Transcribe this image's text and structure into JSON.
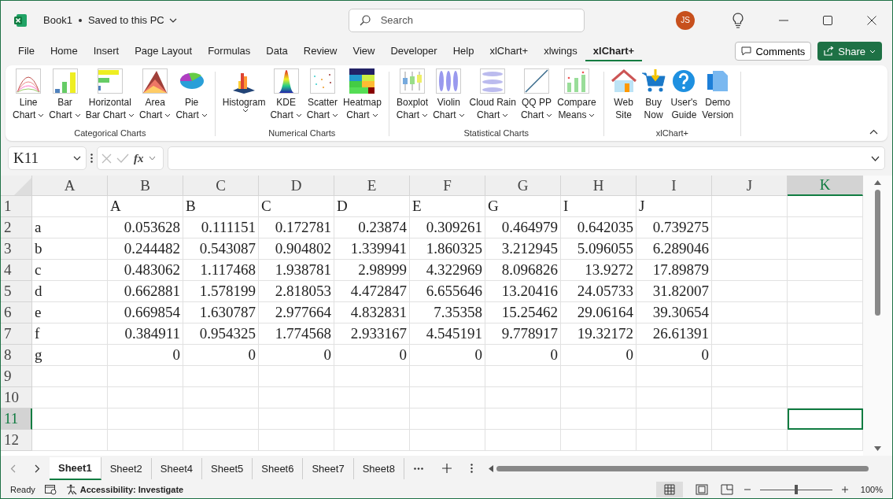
{
  "title_bar": {
    "file_name": "Book1",
    "save_status": "Saved to this PC",
    "search_placeholder": "Search",
    "user_initials": "JS"
  },
  "menu_tabs": [
    {
      "label": "File",
      "selected": false
    },
    {
      "label": "Home",
      "selected": false
    },
    {
      "label": "Insert",
      "selected": false
    },
    {
      "label": "Page Layout",
      "selected": false
    },
    {
      "label": "Formulas",
      "selected": false
    },
    {
      "label": "Data",
      "selected": false
    },
    {
      "label": "Review",
      "selected": false
    },
    {
      "label": "View",
      "selected": false
    },
    {
      "label": "Developer",
      "selected": false
    },
    {
      "label": "Help",
      "selected": false
    },
    {
      "label": "xlChart+",
      "selected": false
    },
    {
      "label": "xlwings",
      "selected": false
    },
    {
      "label": "xlChart+",
      "selected": true
    }
  ],
  "comments_button": "Comments",
  "share_button": "Share",
  "ribbon_groups": [
    {
      "label": "Categorical Charts",
      "buttons": [
        {
          "kind": "line",
          "lines": [
            "Line",
            "Chart"
          ],
          "dropdown": true
        },
        {
          "kind": "bar",
          "lines": [
            "Bar",
            "Chart"
          ],
          "dropdown": true
        },
        {
          "kind": "hbar",
          "lines": [
            "Horizontal",
            "Bar Chart"
          ],
          "dropdown": true
        },
        {
          "kind": "area",
          "lines": [
            "Area",
            "Chart"
          ],
          "dropdown": true
        },
        {
          "kind": "pie",
          "lines": [
            "Pie",
            "Chart"
          ],
          "dropdown": true
        }
      ]
    },
    {
      "label": "Numerical Charts",
      "buttons": [
        {
          "kind": "histogram",
          "lines": [
            "Histogram"
          ],
          "dropdown": true
        },
        {
          "kind": "kde",
          "lines": [
            "KDE",
            "Chart"
          ],
          "dropdown": true
        },
        {
          "kind": "scatter",
          "lines": [
            "Scatter",
            "Chart"
          ],
          "dropdown": true
        },
        {
          "kind": "heatmap",
          "lines": [
            "Heatmap",
            "Chart"
          ],
          "dropdown": true
        }
      ]
    },
    {
      "label": "Statistical Charts",
      "buttons": [
        {
          "kind": "boxplot",
          "lines": [
            "Boxplot",
            "Chart"
          ],
          "dropdown": true
        },
        {
          "kind": "violin",
          "lines": [
            "Violin",
            "Chart"
          ],
          "dropdown": true
        },
        {
          "kind": "cloud",
          "lines": [
            "Cloud Rain",
            "Chart"
          ],
          "dropdown": true
        },
        {
          "kind": "qq",
          "lines": [
            "QQ PP",
            "Chart"
          ],
          "dropdown": true
        },
        {
          "kind": "means",
          "lines": [
            "Compare",
            "Means"
          ],
          "dropdown": true
        }
      ]
    },
    {
      "label": "xlChart+",
      "buttons": [
        {
          "kind": "house",
          "lines": [
            "Web",
            "Site"
          ],
          "dropdown": false
        },
        {
          "kind": "cart",
          "lines": [
            "Buy",
            "Now"
          ],
          "dropdown": false
        },
        {
          "kind": "help",
          "lines": [
            "User's",
            "Guide"
          ],
          "dropdown": false
        },
        {
          "kind": "pages",
          "lines": [
            "Demo",
            "Version"
          ],
          "dropdown": false
        }
      ]
    }
  ],
  "name_box": "K11",
  "formula": {
    "fx_label": "fx"
  },
  "columns": [
    {
      "label": "A",
      "selected": false
    },
    {
      "label": "B",
      "selected": false
    },
    {
      "label": "C",
      "selected": false
    },
    {
      "label": "D",
      "selected": false
    },
    {
      "label": "E",
      "selected": false
    },
    {
      "label": "F",
      "selected": false
    },
    {
      "label": "G",
      "selected": false
    },
    {
      "label": "H",
      "selected": false
    },
    {
      "label": "I",
      "selected": false
    },
    {
      "label": "J",
      "selected": false
    },
    {
      "label": "K",
      "selected": true
    }
  ],
  "rows": [
    {
      "number": "1",
      "selected": false,
      "cells": [
        null,
        {
          "text": "A",
          "kind": "text"
        },
        {
          "text": "B",
          "kind": "text"
        },
        {
          "text": "C",
          "kind": "text"
        },
        {
          "text": "D",
          "kind": "text"
        },
        {
          "text": "E",
          "kind": "text"
        },
        {
          "text": "G",
          "kind": "text"
        },
        {
          "text": "I",
          "kind": "text"
        },
        {
          "text": "J",
          "kind": "text"
        },
        null,
        null
      ]
    },
    {
      "number": "2",
      "selected": false,
      "cells": [
        {
          "text": "a",
          "kind": "text"
        },
        {
          "text": "0.053628",
          "kind": "number"
        },
        {
          "text": "0.111151",
          "kind": "number"
        },
        {
          "text": "0.172781",
          "kind": "number"
        },
        {
          "text": "0.23874",
          "kind": "number"
        },
        {
          "text": "0.309261",
          "kind": "number"
        },
        {
          "text": "0.464979",
          "kind": "number"
        },
        {
          "text": "0.642035",
          "kind": "number"
        },
        {
          "text": "0.739275",
          "kind": "number"
        },
        null,
        null
      ]
    },
    {
      "number": "3",
      "selected": false,
      "cells": [
        {
          "text": "b",
          "kind": "text"
        },
        {
          "text": "0.244482",
          "kind": "number"
        },
        {
          "text": "0.543087",
          "kind": "number"
        },
        {
          "text": "0.904802",
          "kind": "number"
        },
        {
          "text": "1.339941",
          "kind": "number"
        },
        {
          "text": "1.860325",
          "kind": "number"
        },
        {
          "text": "3.212945",
          "kind": "number"
        },
        {
          "text": "5.096055",
          "kind": "number"
        },
        {
          "text": "6.289046",
          "kind": "number"
        },
        null,
        null
      ]
    },
    {
      "number": "4",
      "selected": false,
      "cells": [
        {
          "text": "c",
          "kind": "text"
        },
        {
          "text": "0.483062",
          "kind": "number"
        },
        {
          "text": "1.117468",
          "kind": "number"
        },
        {
          "text": "1.938781",
          "kind": "number"
        },
        {
          "text": "2.98999",
          "kind": "number"
        },
        {
          "text": "4.322969",
          "kind": "number"
        },
        {
          "text": "8.096826",
          "kind": "number"
        },
        {
          "text": "13.9272",
          "kind": "number"
        },
        {
          "text": "17.89879",
          "kind": "number"
        },
        null,
        null
      ]
    },
    {
      "number": "5",
      "selected": false,
      "cells": [
        {
          "text": "d",
          "kind": "text"
        },
        {
          "text": "0.662881",
          "kind": "number"
        },
        {
          "text": "1.578199",
          "kind": "number"
        },
        {
          "text": "2.818053",
          "kind": "number"
        },
        {
          "text": "4.472847",
          "kind": "number"
        },
        {
          "text": "6.655646",
          "kind": "number"
        },
        {
          "text": "13.20416",
          "kind": "number"
        },
        {
          "text": "24.05733",
          "kind": "number"
        },
        {
          "text": "31.82007",
          "kind": "number"
        },
        null,
        null
      ]
    },
    {
      "number": "6",
      "selected": false,
      "cells": [
        {
          "text": "e",
          "kind": "text"
        },
        {
          "text": "0.669854",
          "kind": "number"
        },
        {
          "text": "1.630787",
          "kind": "number"
        },
        {
          "text": "2.977664",
          "kind": "number"
        },
        {
          "text": "4.832831",
          "kind": "number"
        },
        {
          "text": "7.35358",
          "kind": "number"
        },
        {
          "text": "15.25462",
          "kind": "number"
        },
        {
          "text": "29.06164",
          "kind": "number"
        },
        {
          "text": "39.30654",
          "kind": "number"
        },
        null,
        null
      ]
    },
    {
      "number": "7",
      "selected": false,
      "cells": [
        {
          "text": "f",
          "kind": "text"
        },
        {
          "text": "0.384911",
          "kind": "number"
        },
        {
          "text": "0.954325",
          "kind": "number"
        },
        {
          "text": "1.774568",
          "kind": "number"
        },
        {
          "text": "2.933167",
          "kind": "number"
        },
        {
          "text": "4.545191",
          "kind": "number"
        },
        {
          "text": "9.778917",
          "kind": "number"
        },
        {
          "text": "19.32172",
          "kind": "number"
        },
        {
          "text": "26.61391",
          "kind": "number"
        },
        null,
        null
      ]
    },
    {
      "number": "8",
      "selected": false,
      "cells": [
        {
          "text": "g",
          "kind": "text"
        },
        {
          "text": "0",
          "kind": "number"
        },
        {
          "text": "0",
          "kind": "number"
        },
        {
          "text": "0",
          "kind": "number"
        },
        {
          "text": "0",
          "kind": "number"
        },
        {
          "text": "0",
          "kind": "number"
        },
        {
          "text": "0",
          "kind": "number"
        },
        {
          "text": "0",
          "kind": "number"
        },
        {
          "text": "0",
          "kind": "number"
        },
        null,
        null
      ]
    },
    {
      "number": "9",
      "selected": false,
      "cells": []
    },
    {
      "number": "10",
      "selected": false,
      "cells": []
    },
    {
      "number": "11",
      "selected": true,
      "cells": []
    },
    {
      "number": "12",
      "selected": false,
      "cells": []
    }
  ],
  "sheet_tabs": [
    {
      "label": "Sheet1",
      "selected": true
    },
    {
      "label": "Sheet2",
      "selected": false
    },
    {
      "label": "Sheet4",
      "selected": false
    },
    {
      "label": "Sheet5",
      "selected": false
    },
    {
      "label": "Sheet6",
      "selected": false
    },
    {
      "label": "Sheet7",
      "selected": false
    },
    {
      "label": "Sheet8",
      "selected": false
    }
  ],
  "status_bar": {
    "status": "Ready",
    "accessibility": "Accessibility: Investigate",
    "zoom": {
      "level": 0.5,
      "label": "100%"
    }
  }
}
